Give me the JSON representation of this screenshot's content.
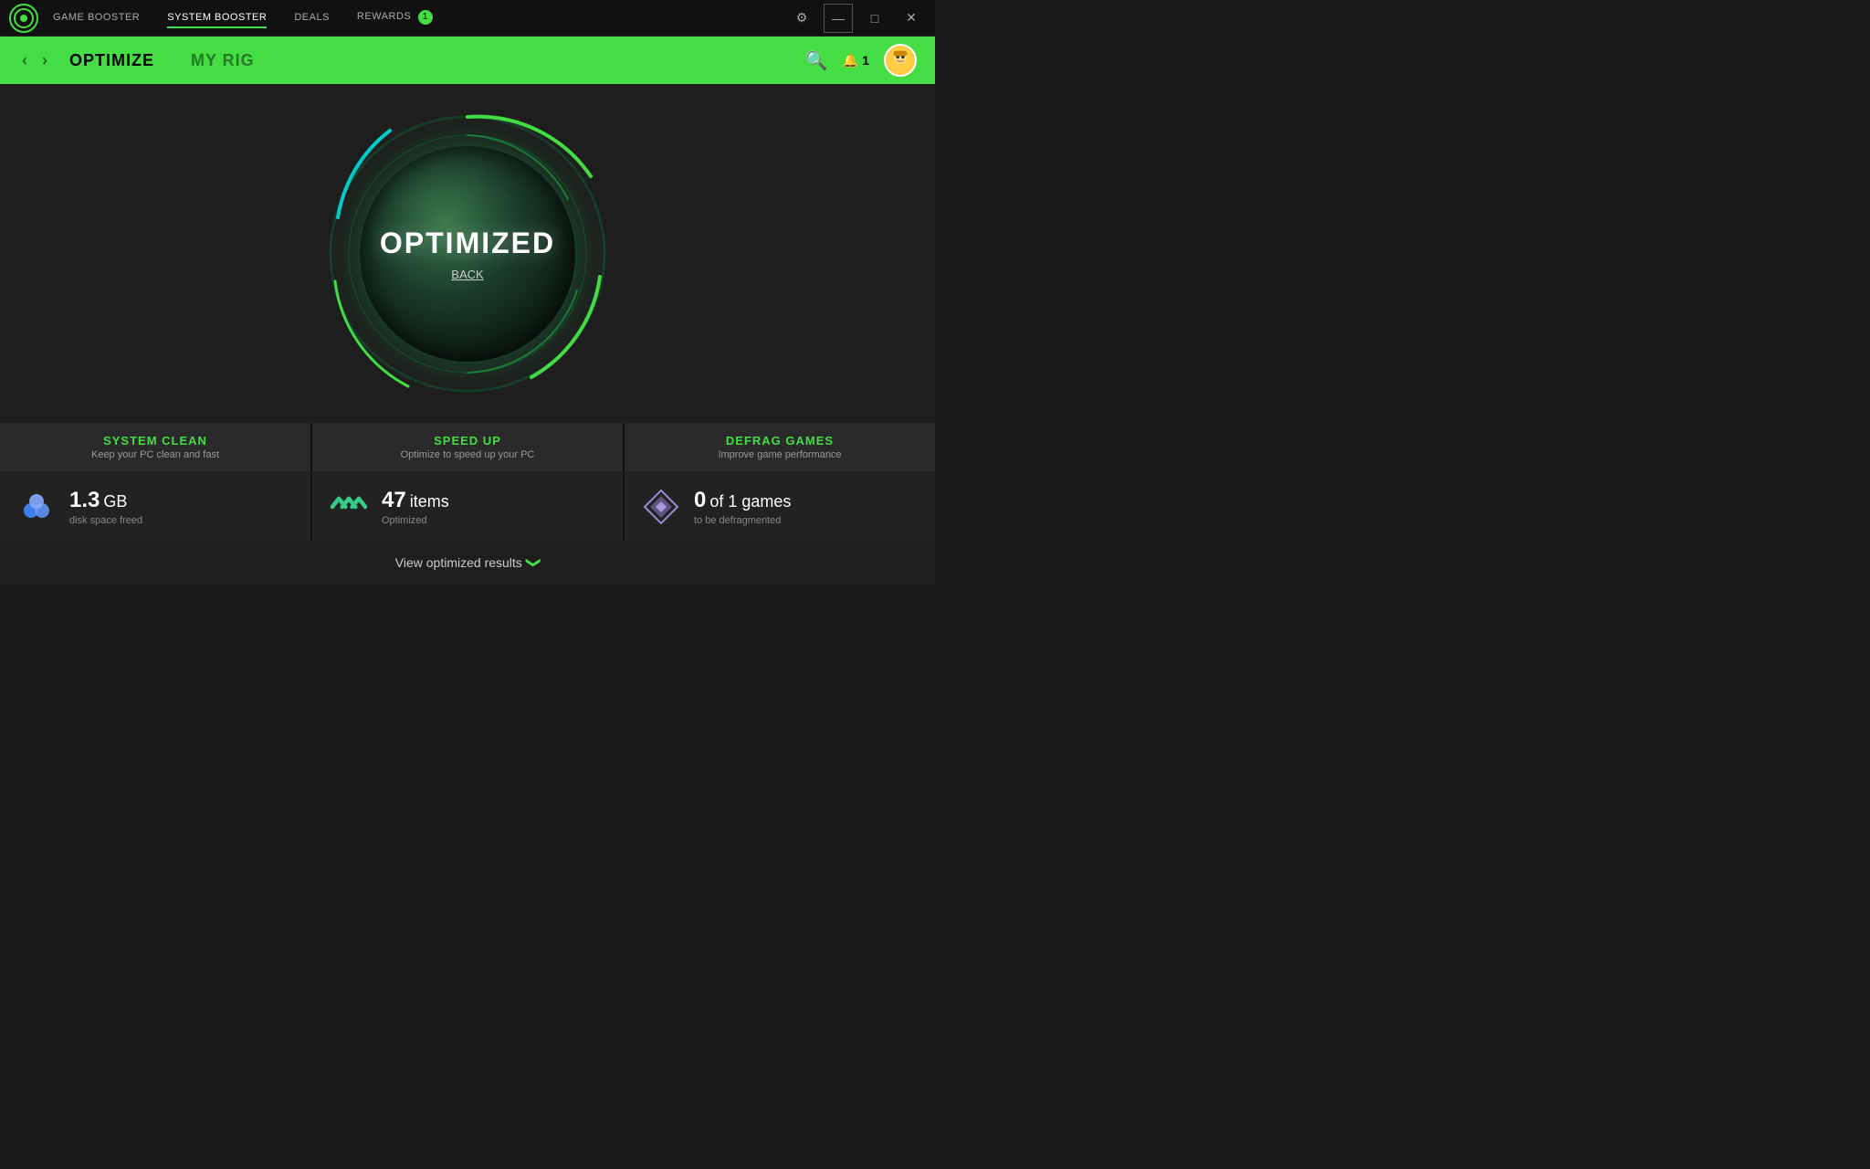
{
  "topNav": {
    "logo": "●",
    "items": [
      {
        "label": "GAME BOOSTER",
        "active": false
      },
      {
        "label": "SYSTEM BOOSTER",
        "active": true
      },
      {
        "label": "DEALS",
        "active": false
      },
      {
        "label": "REWARDS",
        "active": false,
        "badge": "1"
      }
    ],
    "windowControls": {
      "settings": "⚙",
      "minimize": "—",
      "maximize": "□",
      "close": "✕"
    }
  },
  "secondaryNav": {
    "items": [
      {
        "label": "OPTIMIZE",
        "active": true
      },
      {
        "label": "MY RIG",
        "active": false
      }
    ],
    "notifications": "1"
  },
  "main": {
    "optimizedLabel": "OPTIMIZED",
    "backLabel": "BACK"
  },
  "panels": [
    {
      "title": "SYSTEM CLEAN",
      "subtitle": "Keep your PC clean and fast",
      "value": "1.3",
      "unit": "GB",
      "valueLabel": "disk space freed"
    },
    {
      "title": "SPEED UP",
      "subtitle": "Optimize to speed up your PC",
      "value": "47",
      "unit": " items",
      "valueLabel": "Optimized"
    },
    {
      "title": "DEFRAG GAMES",
      "subtitle": "Improve game performance",
      "value": "0",
      "unit": " of 1 games",
      "valueLabel": "to be defragmented"
    }
  ],
  "viewResults": {
    "label": "View optimized results",
    "chevron": "❯"
  }
}
